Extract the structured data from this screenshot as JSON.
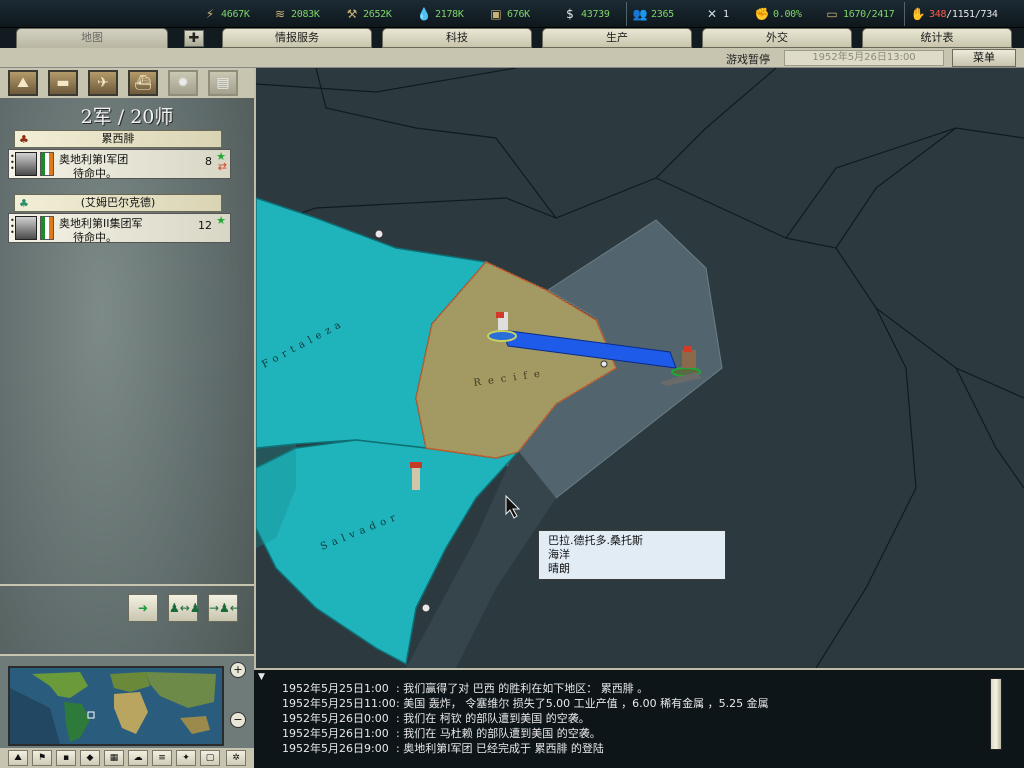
{
  "resources": {
    "energy": "4667K",
    "metal": "2083K",
    "rare_materials": "2652K",
    "oil": "2178K",
    "supplies": "676K",
    "money": "43739",
    "manpower": "2365",
    "diplomacy": "1",
    "dissent": "0.00%",
    "transports": "1670/2417",
    "convoys": [
      "348",
      "/1151/734"
    ]
  },
  "tabs": {
    "map": "地图",
    "intelligence": "情报服务",
    "technology": "科技",
    "production": "生产",
    "diplomacy": "外交",
    "statistics": "统计表"
  },
  "status": {
    "paused": "游戏暂停",
    "date": "1952年5月26日13:00",
    "menu": "菜单"
  },
  "panel": {
    "summary": "2军 / 20师",
    "groups": [
      {
        "name": "累西腓",
        "unit": {
          "name": "奥地利第I军团",
          "state": "待命中。",
          "count": "8"
        }
      },
      {
        "name": "(艾姆巴尔克德)",
        "unit": {
          "name": "奥地利第II集团军",
          "state": "待命中。",
          "count": "12"
        }
      }
    ]
  },
  "map": {
    "labels": [
      "Fortaleza",
      "Recife",
      "Salvador"
    ],
    "tooltip": [
      "巴拉.德托多.桑托斯",
      "海洋",
      "晴朗"
    ]
  },
  "log": [
    {
      "time": "1952年5月25日1:00",
      "text": ": 我们赢得了对 巴西 的胜利在如下地区： 累西腓 。"
    },
    {
      "time": "1952年5月25日11:00",
      "text": ": 美国 轰炸， 令塞维尔 损失了5.00 工业产值 ，6.00 稀有金属 ，5.25 金属"
    },
    {
      "time": "1952年5月26日0:00",
      "text": ": 我们在 柯钦 的部队遭到美国 的空袭。"
    },
    {
      "time": "1952年5月26日1:00",
      "text": ": 我们在 马杜赖 的部队遭到美国 的空袭。"
    },
    {
      "time": "1952年5月26日9:00",
      "text": ": 奥地利第I军团 已经完成于 累西腓 的登陆"
    }
  ],
  "colors": {
    "land_brazil": "#1fb4bb",
    "land_occupied": "#a29a62",
    "sea": "#2c3a3f",
    "sea_zone": "#52656e",
    "arrow": "#1e5be8"
  }
}
